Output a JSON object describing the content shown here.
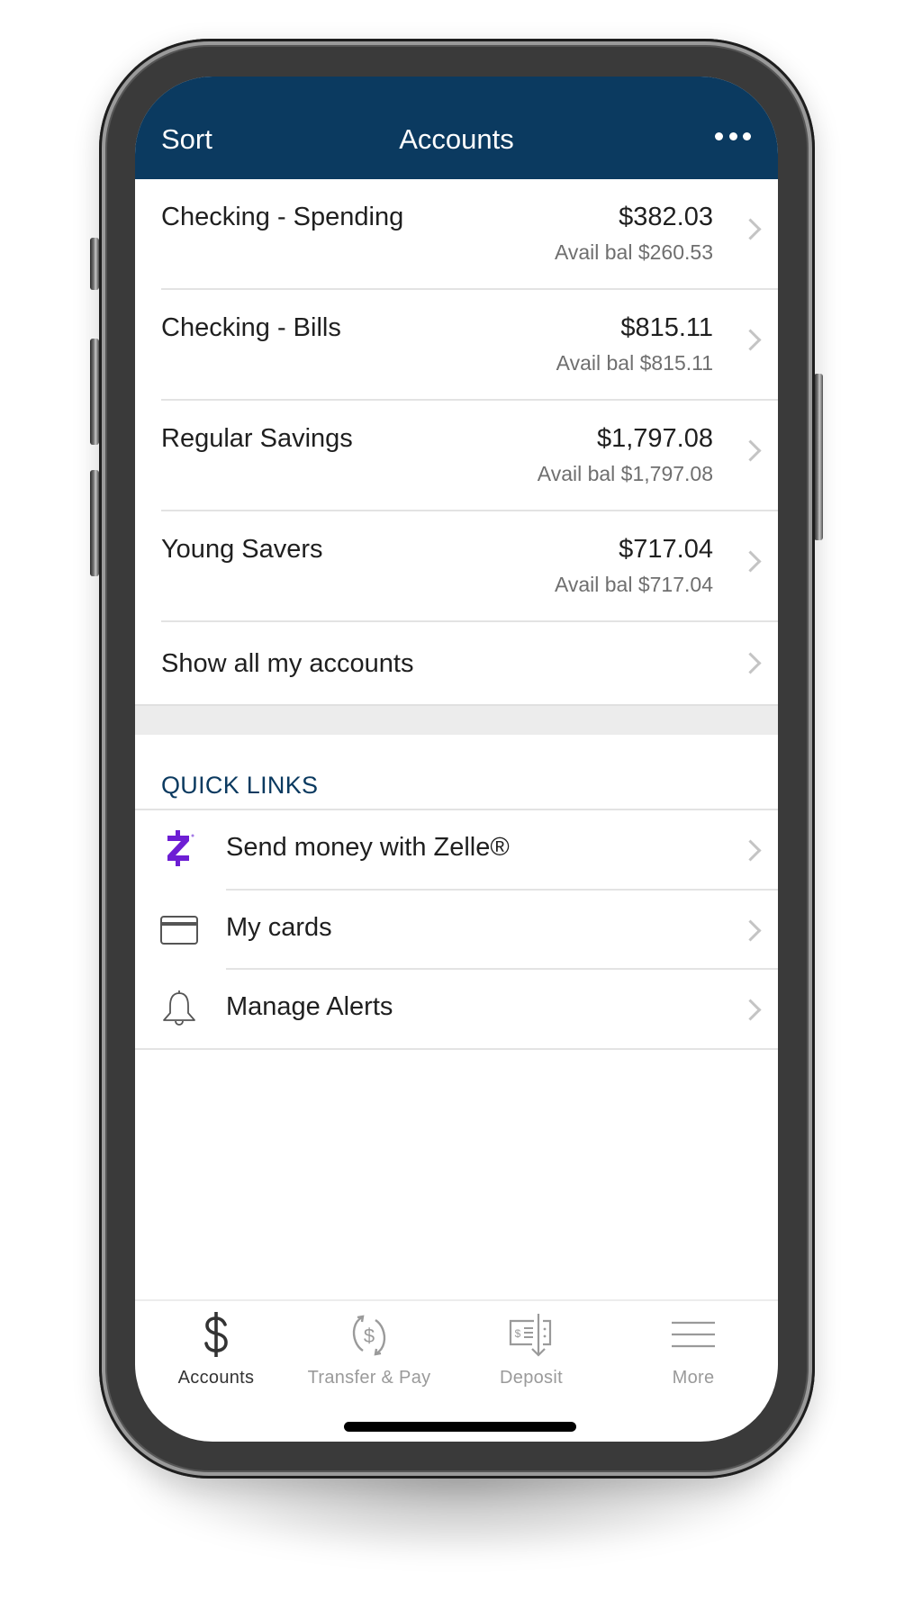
{
  "header": {
    "left_action": "Sort",
    "title": "Accounts",
    "right_action_icon": "more-horizontal-icon"
  },
  "accounts": [
    {
      "name": "Checking - Spending",
      "balance": "$382.03",
      "available": "Avail bal $260.53"
    },
    {
      "name": "Checking - Bills",
      "balance": "$815.11",
      "available": "Avail bal $815.11"
    },
    {
      "name": "Regular Savings",
      "balance": "$1,797.08",
      "available": "Avail bal $1,797.08"
    },
    {
      "name": "Young Savers",
      "balance": "$717.04",
      "available": "Avail bal $717.04"
    }
  ],
  "show_all": {
    "label": "Show all my accounts"
  },
  "quick_links": {
    "title": "QUICK LINKS",
    "items": [
      {
        "label": "Send money with Zelle®",
        "icon": "zelle-icon"
      },
      {
        "label": "My cards",
        "icon": "credit-card-icon"
      },
      {
        "label": "Manage Alerts",
        "icon": "bell-icon"
      }
    ]
  },
  "tabbar": {
    "items": [
      {
        "label": "Accounts",
        "icon": "dollar-icon",
        "active": true
      },
      {
        "label": "Transfer & Pay",
        "icon": "transfer-cycle-icon",
        "active": false
      },
      {
        "label": "Deposit",
        "icon": "check-deposit-icon",
        "active": false
      },
      {
        "label": "More",
        "icon": "hamburger-menu-icon",
        "active": false
      }
    ]
  },
  "colors": {
    "header_bg": "#0b3a60",
    "quick_links_title": "#0b3a60",
    "zelle_purple": "#6d1ed4",
    "chevron": "#c4c4c4",
    "tab_active": "#333333",
    "tab_inactive": "#9a9a9a"
  }
}
